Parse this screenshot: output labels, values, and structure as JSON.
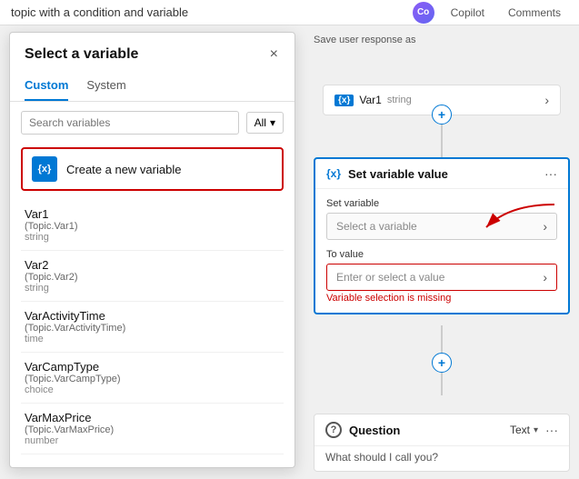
{
  "topbar": {
    "title": "topic with a condition and variable",
    "copilot_label": "Copilot",
    "comments_label": "Comments",
    "copilot_initials": "Co"
  },
  "panel": {
    "title": "Select a variable",
    "close_icon": "×",
    "tabs": [
      {
        "label": "Custom",
        "active": true
      },
      {
        "label": "System",
        "active": false
      }
    ],
    "search_placeholder": "Search variables",
    "filter_label": "All",
    "filter_arrow": "▾",
    "create_btn_label": "Create a new variable",
    "create_btn_icon": "{x}",
    "variables": [
      {
        "name": "Var1",
        "path": "(Topic.Var1)",
        "type": "string"
      },
      {
        "name": "Var2",
        "path": "(Topic.Var2)",
        "type": "string"
      },
      {
        "name": "VarActivityTime",
        "path": "(Topic.VarActivityTime)",
        "type": "time"
      },
      {
        "name": "VarCampType",
        "path": "(Topic.VarCampType)",
        "type": "choice"
      },
      {
        "name": "VarMaxPrice",
        "path": "(Topic.VarMaxPrice)",
        "type": "number"
      }
    ]
  },
  "canvas": {
    "save_response_label": "Save user response as",
    "var1_badge": "{x}",
    "var1_name": "Var1",
    "var1_type": "string",
    "plus_icon": "+",
    "set_variable_title": "Set variable value",
    "set_variable_icon": "{x}",
    "menu_dots": "···",
    "set_variable_label": "Set variable",
    "set_variable_placeholder": "Select a variable",
    "to_value_label": "To value",
    "to_value_placeholder": "Enter or select a value",
    "error_message": "Variable selection is missing",
    "question_title": "Question",
    "question_text": "What should I call you?",
    "text_type": "Text",
    "dropdown_arrow": "▾"
  }
}
